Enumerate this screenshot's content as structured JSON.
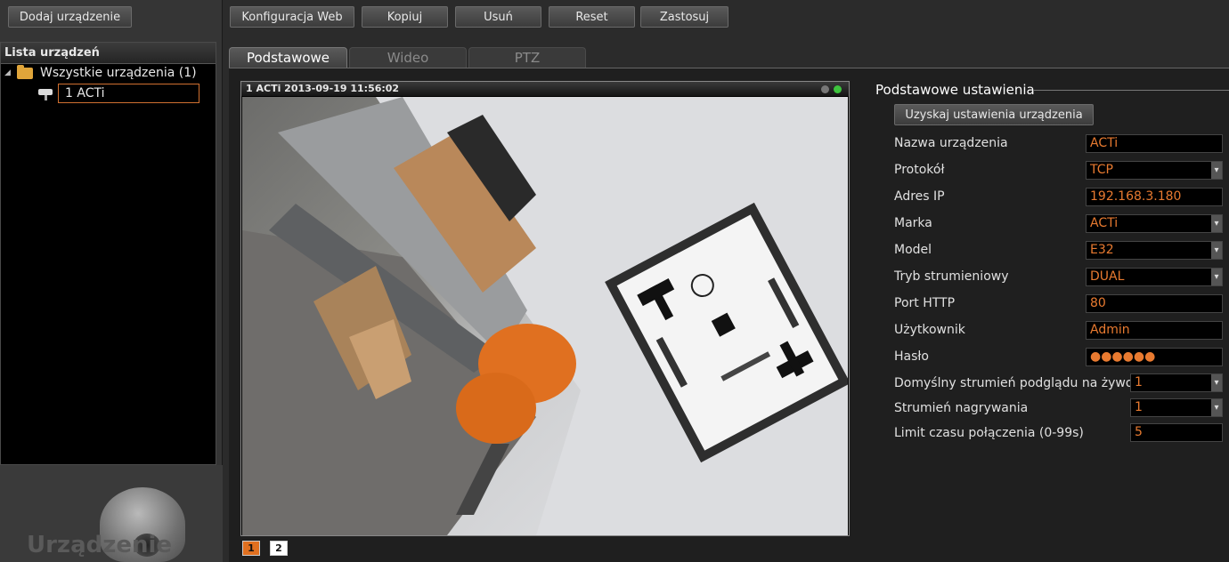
{
  "left_panel": {
    "add_button": "Dodaj urządzenie",
    "list_title": "Lista urządzeń",
    "tree_root": "Wszystkie urządzenia (1)",
    "tree_device": "1 ACTi",
    "section_title": "Urządzenie"
  },
  "toolbar": {
    "web_config": "Konfiguracja Web",
    "copy": "Kopiuj",
    "delete": "Usuń",
    "reset": "Reset",
    "apply": "Zastosuj"
  },
  "tabs": [
    "Podstawowe",
    "Wideo",
    "PTZ"
  ],
  "video": {
    "header": "1 ACTi  2013-09-19 11:56:02",
    "streams": [
      "1",
      "2"
    ]
  },
  "settings": {
    "title": "Podstawowe ustawienia",
    "get_button": "Uzyskaj ustawienia urządzenia",
    "fields": [
      {
        "label": "Nazwa urządzenia",
        "value": "ACTi"
      },
      {
        "label": "Protokół",
        "value": "TCP"
      },
      {
        "label": "Adres IP",
        "value": "192.168.3.180"
      },
      {
        "label": "Marka",
        "value": "ACTi"
      },
      {
        "label": "Model",
        "value": "E32"
      },
      {
        "label": "Tryb strumieniowy",
        "value": "DUAL"
      },
      {
        "label": "Port HTTP",
        "value": "80"
      },
      {
        "label": "Użytkownik",
        "value": "Admin"
      },
      {
        "label": "Hasło",
        "value": "●●●●●●"
      },
      {
        "label": "Domyślny strumień podglądu na żywo",
        "value": "1"
      },
      {
        "label": "Strumień nagrywania",
        "value": "1"
      },
      {
        "label": "Limit czasu połączenia (0-99s)",
        "value": "5"
      }
    ]
  },
  "colors": {
    "accent": "#e87a30",
    "background": "#2b2b2b"
  }
}
